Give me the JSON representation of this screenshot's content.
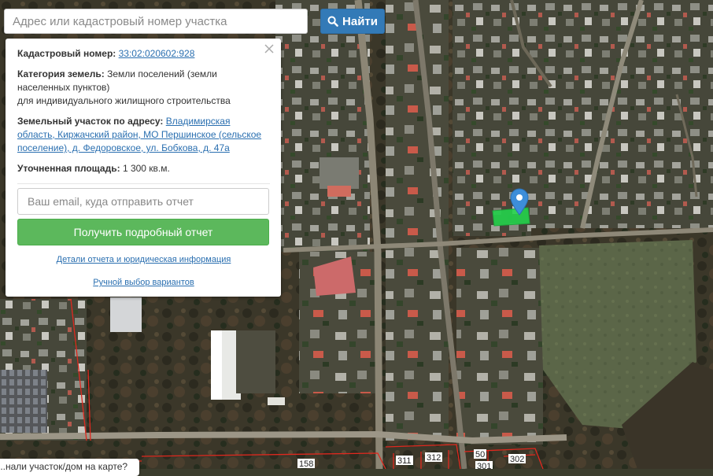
{
  "search": {
    "placeholder": "Адрес или кадастровый номер участка",
    "button_label": "Найти",
    "button_icon": "search-icon",
    "accent_color": "#337ab7"
  },
  "info_panel": {
    "cadastral_label": "Кадастровый номер:",
    "cadastral_number": "33:02:020602:928",
    "category_label": "Категория земель:",
    "category_value": "Земли поселений (земли населенных пунктов)",
    "category_usage": "для индивидуального жилищного строительства",
    "address_label": "Земельный участок по адресу:",
    "address_value": "Владимирская область, Киржачский район, МО Першинское (сельское поселение), д. Федоровское, ул. Бобкова, д. 47а",
    "area_label": "Уточненная площадь:",
    "area_value": "1 300 кв.м.",
    "email_placeholder": "Ваш email, куда отправить отчет",
    "report_button": "Получить подробный отчет",
    "report_button_color": "#5cb85c",
    "details_link": "Детали отчета и юридическая информация",
    "manual_link": "Ручной выбор вариантов"
  },
  "map": {
    "parcel_numbers": [
      "158",
      "311",
      "312",
      "50",
      "302",
      "301"
    ],
    "marker_icon": "map-pin-icon",
    "marker_color": "#3d8ed9",
    "highlight_color": "#23d24b",
    "boundary_color": "#e0281e"
  },
  "bottom_tooltip": {
    "text": "...нали участок/дом на карте?"
  }
}
